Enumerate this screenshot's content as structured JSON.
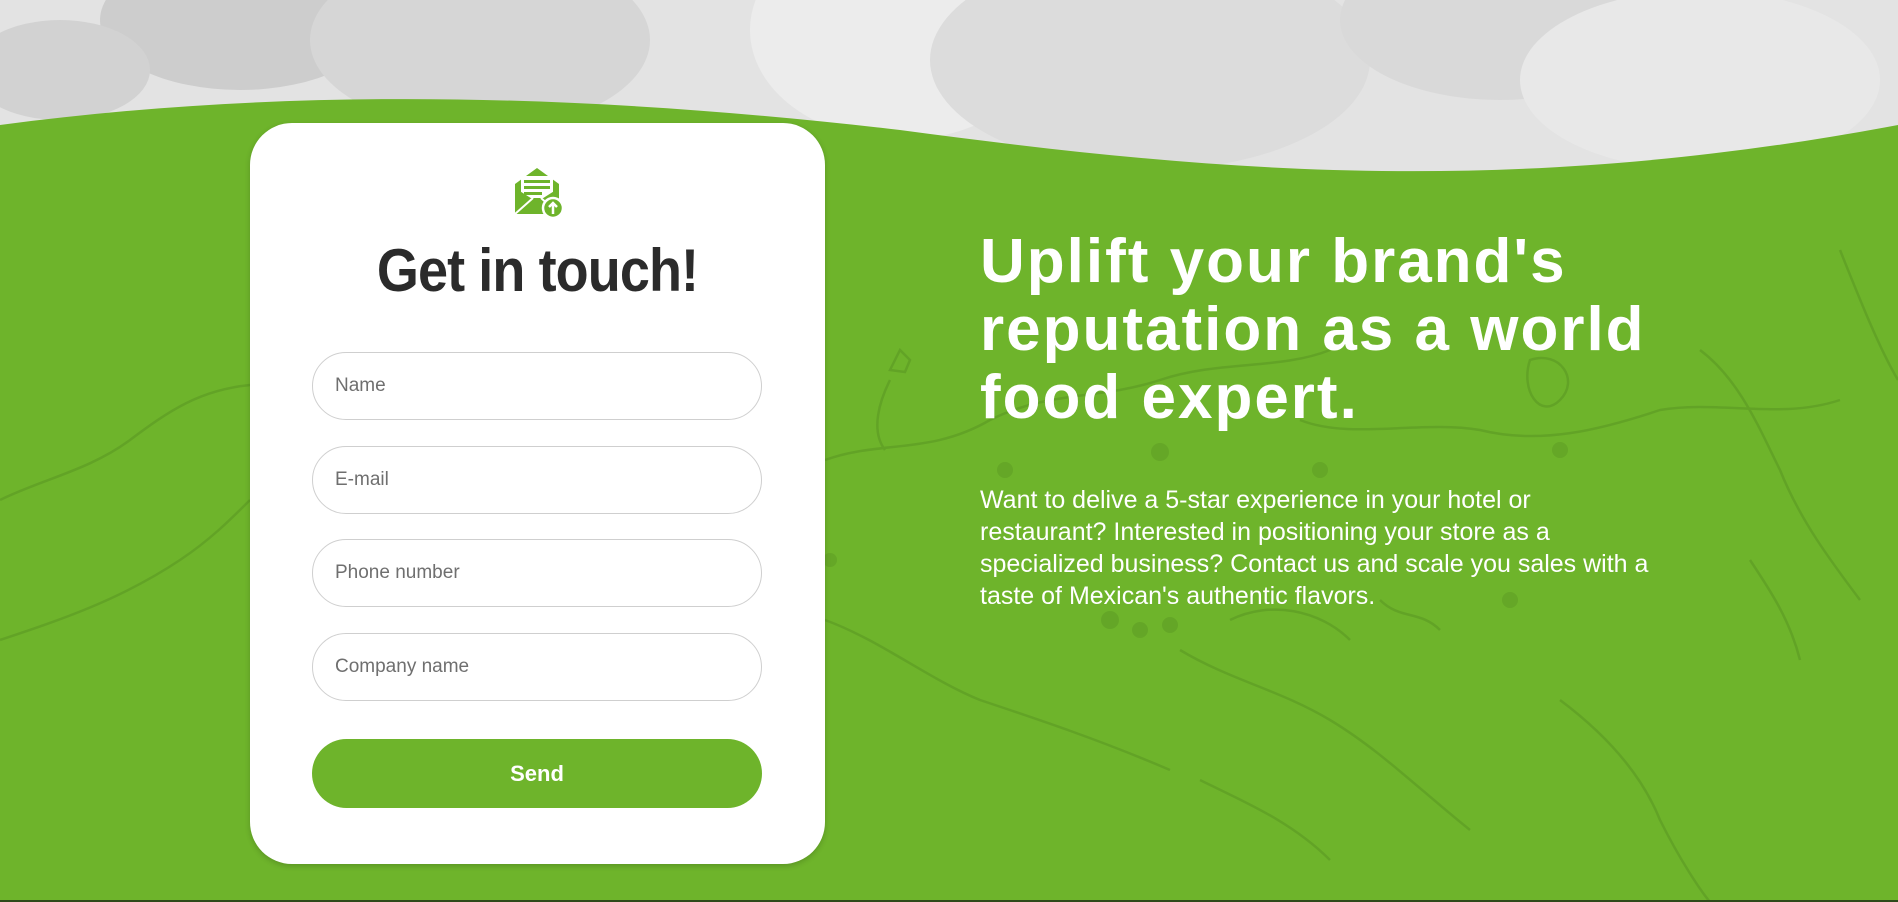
{
  "contact_card": {
    "title": "Get in touch!",
    "fields": {
      "name_placeholder": "Name",
      "email_placeholder": "E-mail",
      "phone_placeholder": "Phone number",
      "company_placeholder": "Company name"
    },
    "send_label": "Send",
    "icon": "mail-upload-icon"
  },
  "promo": {
    "headline": "Uplift your brand's reputation as a world food expert.",
    "description": "Want to delive a 5-star experience in your hotel or restaurant? Interested in positioning your store as a specialized business? Contact us and scale you sales with a taste of Mexican's authentic flavors."
  },
  "colors": {
    "brand_green": "#6eb42b",
    "card_background": "#ffffff",
    "title_text": "#2b2b2b"
  }
}
